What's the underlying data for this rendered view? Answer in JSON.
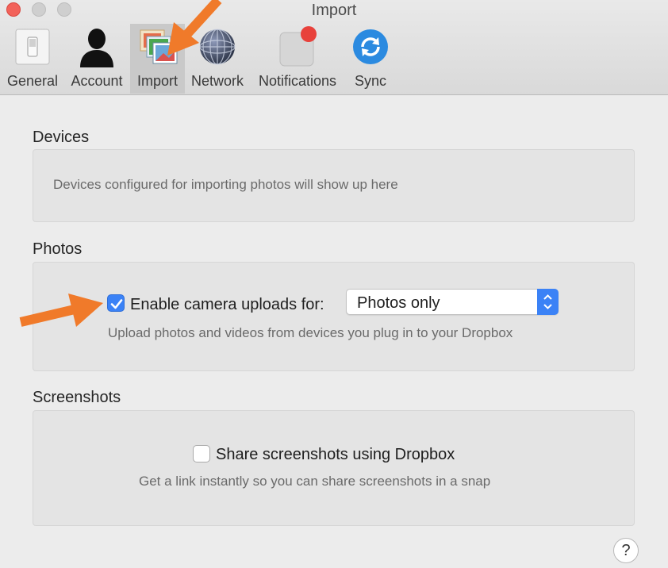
{
  "window": {
    "title": "Import"
  },
  "toolbar": {
    "tabs": [
      {
        "label": "General",
        "icon": "switch-icon"
      },
      {
        "label": "Account",
        "icon": "person-silhouette-icon"
      },
      {
        "label": "Import",
        "icon": "photos-stack-icon",
        "selected": true
      },
      {
        "label": "Network",
        "icon": "globe-icon"
      },
      {
        "label": "Notifications",
        "icon": "notification-badge-icon"
      },
      {
        "label": "Sync",
        "icon": "sync-icon"
      }
    ]
  },
  "devices": {
    "title": "Devices",
    "empty_text": "Devices configured for importing photos will show up here"
  },
  "photos": {
    "title": "Photos",
    "checkbox_label": "Enable camera uploads for:",
    "checked": true,
    "select_value": "Photos only",
    "description": "Upload photos and videos from devices you plug in to your Dropbox"
  },
  "screenshots": {
    "title": "Screenshots",
    "checkbox_label": "Share screenshots using Dropbox",
    "checked": false,
    "description": "Get a link instantly so you can share screenshots in a snap"
  },
  "help": {
    "label": "?"
  },
  "colors": {
    "accent": "#3b82f6",
    "annotation_arrow": "#f07a2a",
    "close_button": "#f2625a",
    "notification_badge": "#e8413b"
  }
}
